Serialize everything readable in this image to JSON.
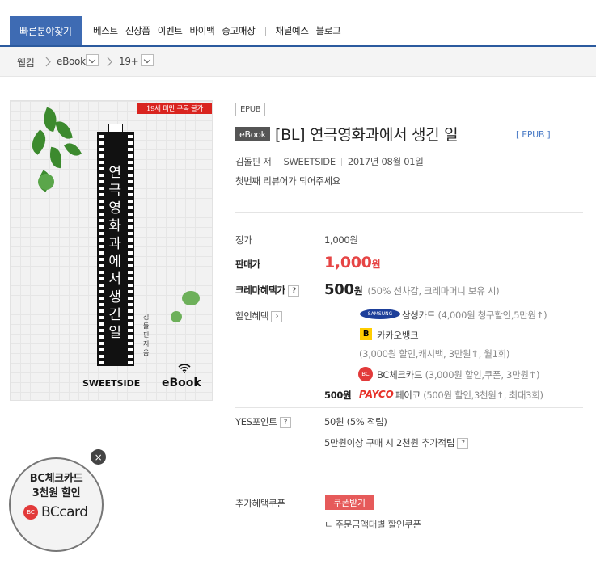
{
  "header": {
    "category_button": "빠른분야찾기",
    "nav": [
      "베스트",
      "신상품",
      "이벤트",
      "바이백",
      "중고매장"
    ],
    "nav2": [
      "채널예스",
      "블로그"
    ]
  },
  "breadcrumb": {
    "home": "웰컴",
    "level1": "eBook",
    "level2": "19+"
  },
  "cover": {
    "age_notice": "19세 미만 구독 불가",
    "title_vertical": "연극영화과에서 생긴 일",
    "author_vertical": "김돌핀 지음",
    "publisher": "SWEETSIDE",
    "ebook_logo": "eBook"
  },
  "product": {
    "format_tag": "EPUB",
    "ebook_badge": "eBook",
    "title": "[BL] 연극영화과에서 생긴 일",
    "format_small": "[ EPUB ]",
    "author": "김돌핀 저",
    "publisher": "SWEETSIDE",
    "date": "2017년 08월 01일",
    "review_prompt": "첫번째 리뷰어가 되어주세요"
  },
  "pricing": {
    "list_price_label": "정가",
    "list_price": "1,000원",
    "sale_price_label": "판매가",
    "sale_price_num": "1,000",
    "sale_price_unit": "원",
    "crema_label": "크레마혜택가",
    "crema_price_num": "500",
    "crema_price_unit": "원",
    "crema_note": "(50% 선차감, 크레마머니 보유 시)",
    "discount_label": "할인혜택",
    "discounts": [
      {
        "logo": "SAMSUNG",
        "name": "삼성카드",
        "detail": "(4,000원 청구할인,5만원↑)"
      },
      {
        "logo": "B",
        "name": "카카오뱅크",
        "detail": "(3,000원 할인,캐시백, 3만원↑, 월1회)"
      },
      {
        "logo": "BC",
        "name": "BC체크카드",
        "detail": "(3,000원 할인,쿠폰, 3만원↑)"
      },
      {
        "amount": "500원",
        "logo": "PAYCO",
        "name": "페이코",
        "detail": "(500원 할인,3천원↑, 최대3회)"
      }
    ],
    "points_label": "YES포인트",
    "points_value": "50원 (5% 적립)",
    "points_extra": "5만원이상 구매 시 2천원 추가적립",
    "coupon_label": "추가혜택쿠폰",
    "coupon_button": "쿠폰받기",
    "coupon_note": "ㄴ 주문금액대별 할인쿠폰"
  },
  "bc_banner": {
    "line1": "BC체크카드",
    "line2": "3천원 할인",
    "logo_mark": "BC",
    "logo_text": "BCcard",
    "close": "×"
  },
  "help_glyph": "?",
  "colors": {
    "accent_blue": "#3e6bb3",
    "price_red": "#e64545",
    "coupon_red": "#e65a5a"
  }
}
